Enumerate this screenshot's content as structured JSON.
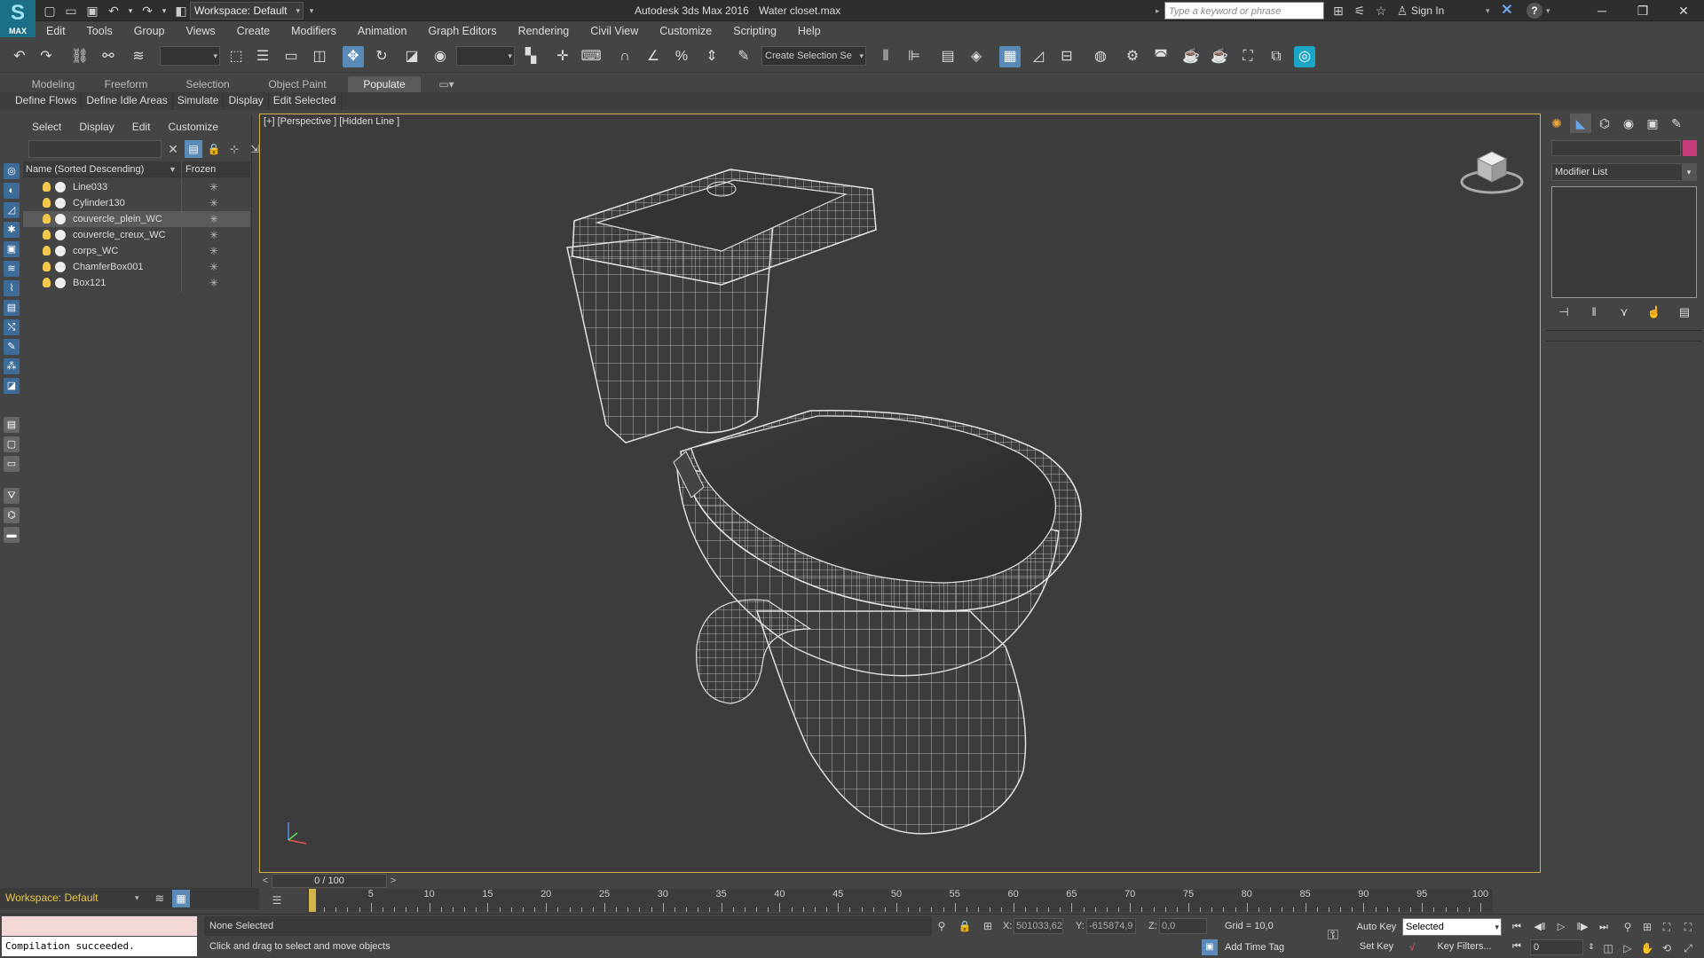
{
  "window": {
    "app_title": "Autodesk 3ds Max 2016",
    "doc_title": "Water closet.max",
    "logo_text": "MAX",
    "workspace": "Workspace: Default",
    "search_placeholder": "Type a keyword or phrase",
    "sign_in": "Sign In"
  },
  "menu": [
    "Edit",
    "Tools",
    "Group",
    "Views",
    "Create",
    "Modifiers",
    "Animation",
    "Graph Editors",
    "Rendering",
    "Civil View",
    "Customize",
    "Scripting",
    "Help"
  ],
  "toolbar": {
    "selection_filter": "",
    "reference_coord": "",
    "named_selection_placeholder": "Create Selection Se"
  },
  "ribbon": {
    "tabs": [
      "Modeling",
      "Freeform",
      "Selection",
      "Object Paint",
      "Populate"
    ],
    "active_tab": "Populate",
    "panel_items": [
      "Define Flows",
      "Define Idle Areas",
      "Simulate",
      "Display",
      "Edit Selected"
    ]
  },
  "scene_explorer": {
    "menu": [
      "Select",
      "Display",
      "Edit",
      "Customize"
    ],
    "col_name": "Name (Sorted Descending)",
    "col_frozen": "Frozen",
    "rows": [
      {
        "name": "Line033",
        "selected": false
      },
      {
        "name": "Cylinder130",
        "selected": false
      },
      {
        "name": "couvercle_plein_WC",
        "selected": true
      },
      {
        "name": "couvercle_creux_WC",
        "selected": false
      },
      {
        "name": "corps_WC",
        "selected": false
      },
      {
        "name": "ChamferBox001",
        "selected": false
      },
      {
        "name": "Box121",
        "selected": false
      }
    ]
  },
  "viewport": {
    "label": "[+] [Perspective ] [Hidden Line ]"
  },
  "command_panel": {
    "modifier_list": "Modifier List",
    "object_color": "#c53c7a"
  },
  "timeline": {
    "slider_text": "0 / 100",
    "current_frame": 0,
    "start": 0,
    "end": 100,
    "labels": [
      5,
      10,
      15,
      20,
      25,
      30,
      35,
      40,
      45,
      50,
      55,
      60,
      65,
      70,
      75,
      80,
      85,
      90,
      95,
      100
    ]
  },
  "status": {
    "workspace": "Workspace: Default",
    "listener_output": "Compilation succeeded.",
    "selection": "None Selected",
    "prompt": "Click and drag to select and move objects",
    "x_label": "X:",
    "x_value": "501033,62",
    "y_label": "Y:",
    "y_value": "-615874,9",
    "z_label": "Z:",
    "z_value": "0,0",
    "grid": "Grid = 10,0",
    "add_time_tag": "Add Time Tag",
    "auto_key": "Auto Key",
    "set_key": "Set Key",
    "selected_set": "Selected",
    "key_filters": "Key Filters...",
    "frame_value": "0"
  },
  "colors": {
    "accent": "#5a8ab8",
    "viewport_border": "#d4b44a",
    "workspace_text": "#e6c84a"
  }
}
